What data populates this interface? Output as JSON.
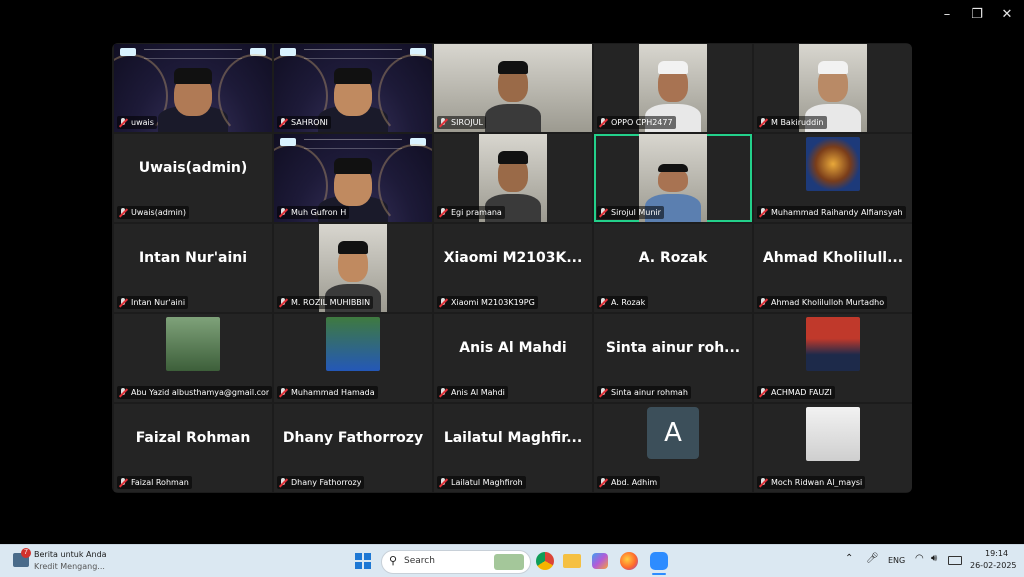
{
  "window": {
    "minimize_icon": "–",
    "restore_icon": "❐",
    "close_icon": "✕"
  },
  "participants": [
    {
      "label": "uwais",
      "kind": "slide"
    },
    {
      "label": "SAHRONI",
      "kind": "slide"
    },
    {
      "label": "SIROJUL",
      "kind": "camera"
    },
    {
      "label": "OPPO CPH2477",
      "kind": "camera"
    },
    {
      "label": "M Bakiruddin",
      "kind": "camera"
    },
    {
      "label": "Uwais(admin)",
      "display": "Uwais(admin)",
      "kind": "name"
    },
    {
      "label": "Muh Gufron H",
      "kind": "slide"
    },
    {
      "label": "Egi pramana",
      "kind": "camera"
    },
    {
      "label": "Sirojul Munir",
      "kind": "camera",
      "active": true
    },
    {
      "label": "Muhammad Raihandy Alfiansyah",
      "kind": "avatar"
    },
    {
      "label": "Intan Nur'aini",
      "display": "Intan Nur'aini",
      "kind": "name"
    },
    {
      "label": "M. ROZIL MUHIBBIN",
      "kind": "camera"
    },
    {
      "label": "Xiaomi M2103K19PG",
      "display": "Xiaomi  M2103K...",
      "kind": "name"
    },
    {
      "label": "A. Rozak",
      "display": "A. Rozak",
      "kind": "name"
    },
    {
      "label": "Ahmad Kholilulloh Murtadho",
      "display": "Ahmad  Kholilull...",
      "kind": "name"
    },
    {
      "label": "Abu Yazid albusthamya@gmail.com",
      "kind": "avatar"
    },
    {
      "label": "Muhammad Hamada",
      "kind": "avatar"
    },
    {
      "label": "Anis Al Mahdi",
      "display": "Anis Al Mahdi",
      "kind": "name"
    },
    {
      "label": "Sinta ainur rohmah",
      "display": "Sinta  ainur  roh...",
      "kind": "name"
    },
    {
      "label": "ACHMAD FAUZI",
      "kind": "avatar"
    },
    {
      "label": "Faizal Rohman",
      "display": "Faizal Rohman",
      "kind": "name"
    },
    {
      "label": "Dhany Fathorrozy",
      "display": "Dhany Fathorrozy",
      "kind": "name"
    },
    {
      "label": "Lailatul Maghfiroh",
      "display": "Lailatul  Maghfir...",
      "kind": "name"
    },
    {
      "label": "Abd. Adhim",
      "kind": "letter",
      "letter": "A"
    },
    {
      "label": "Moch Ridwan Al_maysi",
      "kind": "avatar"
    }
  ],
  "taskbar": {
    "news_title": "Berita untuk Anda",
    "news_sub": "Kredit Mengang...",
    "news_badge": "7",
    "search_placeholder": "Search",
    "language": "ENG",
    "time": "19:14",
    "date": "26-02-2025"
  }
}
